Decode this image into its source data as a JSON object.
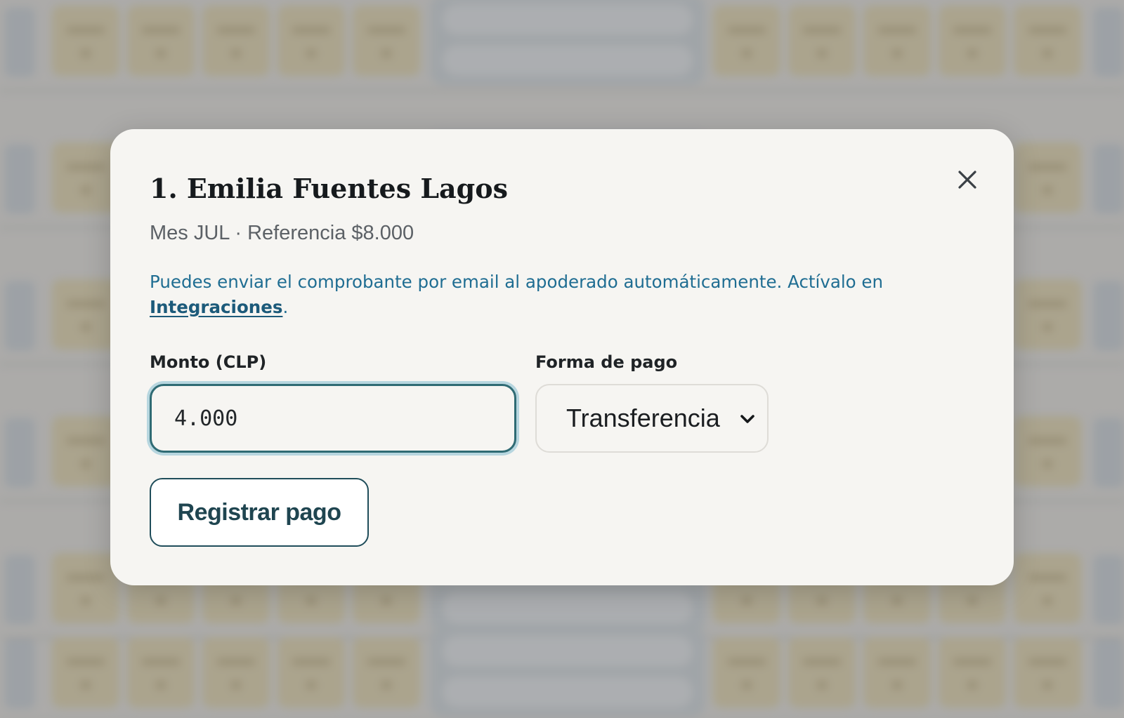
{
  "background": {
    "header_fragment": "P"
  },
  "modal": {
    "title": "1. Emilia Fuentes Lagos",
    "subtitle": "Mes JUL · Referencia $8.000",
    "info_text": "Puedes enviar el comprobante por email al apoderado automáticamente. Actívalo en ",
    "info_link": "Integraciones",
    "info_suffix": ".",
    "amount_label": "Monto (CLP)",
    "amount_value": "4.000",
    "payment_method_label": "Forma de pago",
    "payment_method_value": "Transferencia",
    "submit_label": "Registrar pago",
    "close_icon": "close-icon",
    "chevron_icon": "chevron-down-icon"
  },
  "colors": {
    "modal_bg": "#f6f5f2",
    "accent_link": "#1f6d92",
    "primary_border": "#1f4d5a",
    "focus_ring": "#b7d6df",
    "overlay": "#707275"
  }
}
